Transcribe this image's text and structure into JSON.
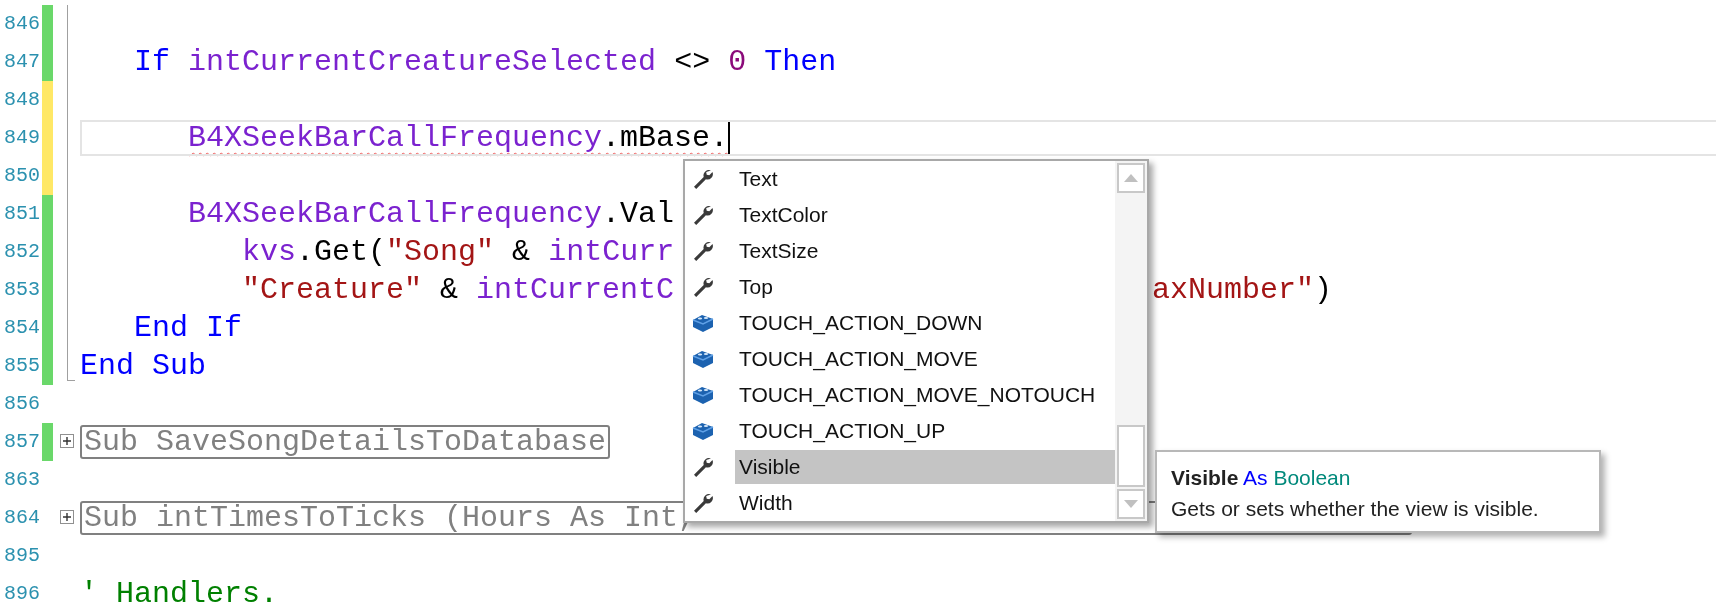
{
  "editor": {
    "lines": [
      {
        "number": "846",
        "color": "#6ad86a",
        "in_fold": true,
        "fold_end": false,
        "current": false
      },
      {
        "number": "847",
        "color": "#6ad86a",
        "in_fold": true,
        "fold_end": false,
        "current": false,
        "tokens": [
          {
            "kind": "keyword",
            "text": "   If "
          },
          {
            "kind": "identifier",
            "text": "intCurrentCreatureSelected "
          },
          {
            "kind": "plain",
            "text": "<> "
          },
          {
            "kind": "number",
            "text": "0 "
          },
          {
            "kind": "keyword",
            "text": "Then"
          }
        ]
      },
      {
        "number": "848",
        "color": "#ffe866",
        "in_fold": true,
        "fold_end": false,
        "current": false
      },
      {
        "number": "849",
        "color": "#ffe866",
        "in_fold": true,
        "fold_end": false,
        "current": true,
        "tokens": [
          {
            "kind": "identifier",
            "text": "      B4XSeekBarCallFrequency",
            "error": true
          },
          {
            "kind": "plain",
            "text": ".mBase.",
            "error": true
          }
        ]
      },
      {
        "number": "850",
        "color": "#ffe866",
        "in_fold": true,
        "fold_end": false,
        "current": false
      },
      {
        "number": "851",
        "color": "#6ad86a",
        "in_fold": true,
        "fold_end": false,
        "current": false,
        "tokens": [
          {
            "kind": "identifier",
            "text": "      B4XSeekBarCallFrequency"
          },
          {
            "kind": "plain",
            "text": ".Val"
          }
        ]
      },
      {
        "number": "852",
        "color": "#6ad86a",
        "in_fold": true,
        "fold_end": false,
        "current": false,
        "tokens": [
          {
            "kind": "identifier",
            "text": "         kvs"
          },
          {
            "kind": "plain",
            "text": ".Get("
          },
          {
            "kind": "string",
            "text": "\"Song\""
          },
          {
            "kind": "plain",
            "text": " & "
          },
          {
            "kind": "identifier",
            "text": "intCurr"
          }
        ]
      },
      {
        "number": "853",
        "color": "#6ad86a",
        "in_fold": true,
        "fold_end": false,
        "current": false,
        "tokens": [
          {
            "kind": "string",
            "text": "         \"Creature\""
          },
          {
            "kind": "plain",
            "text": " & "
          },
          {
            "kind": "identifier",
            "text": "intCurrentC"
          }
        ],
        "tail": [
          {
            "kind": "string",
            "text": "axNumber\""
          },
          {
            "kind": "plain",
            "text": ")"
          }
        ]
      },
      {
        "number": "854",
        "color": "#6ad86a",
        "in_fold": true,
        "fold_end": false,
        "current": false,
        "tokens": [
          {
            "kind": "keyword",
            "text": "   End If"
          }
        ]
      },
      {
        "number": "855",
        "color": "#6ad86a",
        "in_fold": true,
        "fold_end": true,
        "current": false,
        "tokens": [
          {
            "kind": "keyword",
            "text": "End Sub"
          }
        ]
      },
      {
        "number": "856",
        "in_fold": false,
        "current": false
      },
      {
        "number": "857",
        "color": "#6ad86a",
        "in_fold": false,
        "current": false,
        "collapsed": {
          "text": "Sub SaveSongDetailsToDatabase",
          "truncated": false
        }
      },
      {
        "number": "863",
        "in_fold": false,
        "current": false
      },
      {
        "number": "864",
        "in_fold": false,
        "current": false,
        "collapsed": {
          "text": "Sub intTimesToTicks (Hours As Int,",
          "truncated": true
        }
      },
      {
        "number": "895",
        "in_fold": false,
        "current": false
      },
      {
        "number": "896",
        "in_fold": false,
        "current": false,
        "tokens": [
          {
            "kind": "comment",
            "text": "' Handlers."
          }
        ]
      }
    ]
  },
  "completion": {
    "items": [
      {
        "kind": "property",
        "label": "Text",
        "selected": false
      },
      {
        "kind": "property",
        "label": "TextColor",
        "selected": false
      },
      {
        "kind": "property",
        "label": "TextSize",
        "selected": false
      },
      {
        "kind": "property",
        "label": "Top",
        "selected": false
      },
      {
        "kind": "constant",
        "label": "TOUCH_ACTION_DOWN",
        "selected": false
      },
      {
        "kind": "constant",
        "label": "TOUCH_ACTION_MOVE",
        "selected": false
      },
      {
        "kind": "constant",
        "label": "TOUCH_ACTION_MOVE_NOTOUCH",
        "selected": false
      },
      {
        "kind": "constant",
        "label": "TOUCH_ACTION_UP",
        "selected": false
      },
      {
        "kind": "property",
        "label": "Visible",
        "selected": true
      },
      {
        "kind": "property",
        "label": "Width",
        "selected": false
      }
    ]
  },
  "tooltip": {
    "name": "Visible",
    "keyword": "As",
    "type": "Boolean",
    "description": "Gets or sets whether the view is visible."
  }
}
